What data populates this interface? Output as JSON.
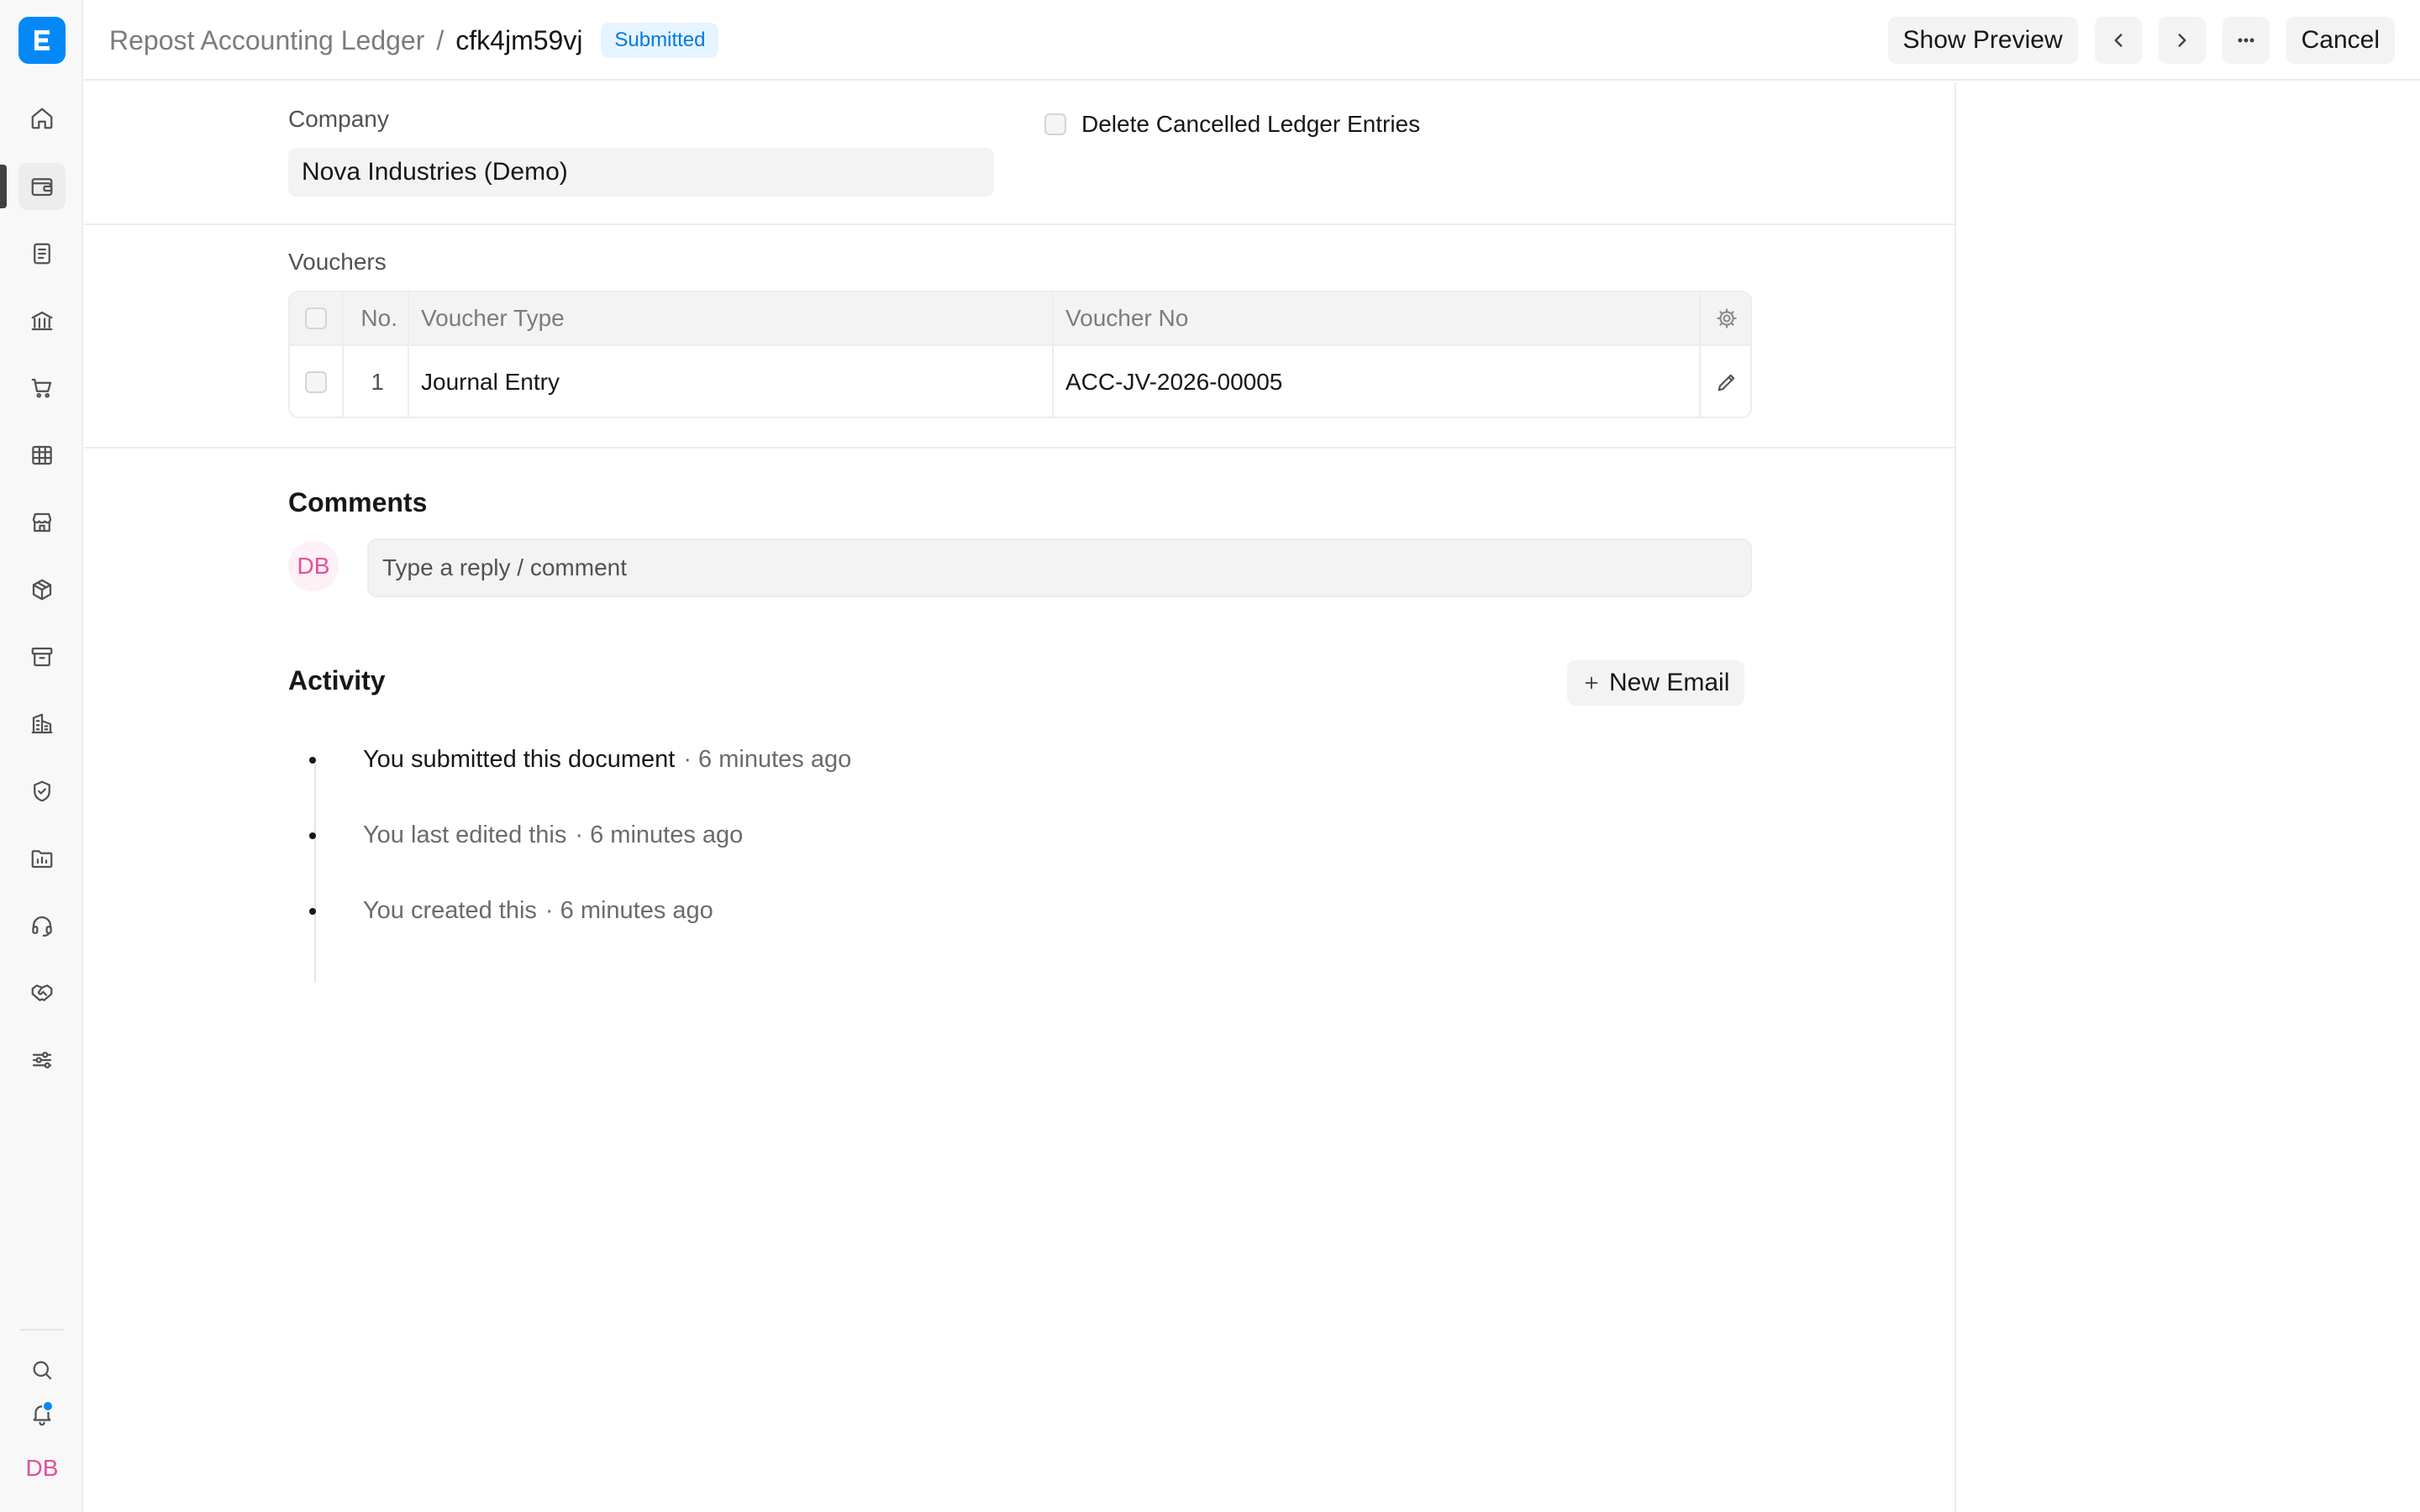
{
  "rail": {
    "logo_letter": "E",
    "items": [
      "home-icon",
      "wallet-icon",
      "document-icon",
      "bank-icon",
      "cart-icon",
      "table-icon",
      "store-icon",
      "package-icon",
      "archive-icon",
      "building-icon",
      "shield-icon",
      "folder-chart-icon",
      "headset-icon",
      "handshake-icon",
      "sliders-icon"
    ],
    "bottom": [
      "search-icon",
      "bell-icon"
    ],
    "user_initials": "DB"
  },
  "header": {
    "breadcrumb_parent": "Repost Accounting Ledger",
    "breadcrumb_sep": "/",
    "doc_name": "cfk4jm59vj",
    "status": "Submitted",
    "show_preview": "Show Preview",
    "cancel": "Cancel"
  },
  "form": {
    "company_label": "Company",
    "company_value": "Nova Industries (Demo)",
    "delete_cancelled_label": "Delete Cancelled Ledger Entries",
    "vouchers_label": "Vouchers",
    "vouchers_columns": {
      "no": "No.",
      "voucher_type": "Voucher Type",
      "voucher_no": "Voucher No"
    },
    "vouchers_rows": [
      {
        "no": "1",
        "voucher_type": "Journal Entry",
        "voucher_no": "ACC-JV-2026-00005"
      }
    ]
  },
  "comments": {
    "title": "Comments",
    "avatar": "DB",
    "placeholder": "Type a reply / comment"
  },
  "activity": {
    "title": "Activity",
    "new_email": "New Email",
    "items": [
      {
        "text": "You submitted this document",
        "time": "· 6 minutes ago"
      },
      {
        "text": "You last edited this",
        "time": "· 6 minutes ago"
      },
      {
        "text": "You created this",
        "time": "· 6 minutes ago"
      }
    ]
  },
  "colors": {
    "accent": "#0289f7",
    "status_bg": "#e6f4ff",
    "status_fg": "#007be0",
    "avatar": "#e2509b"
  }
}
